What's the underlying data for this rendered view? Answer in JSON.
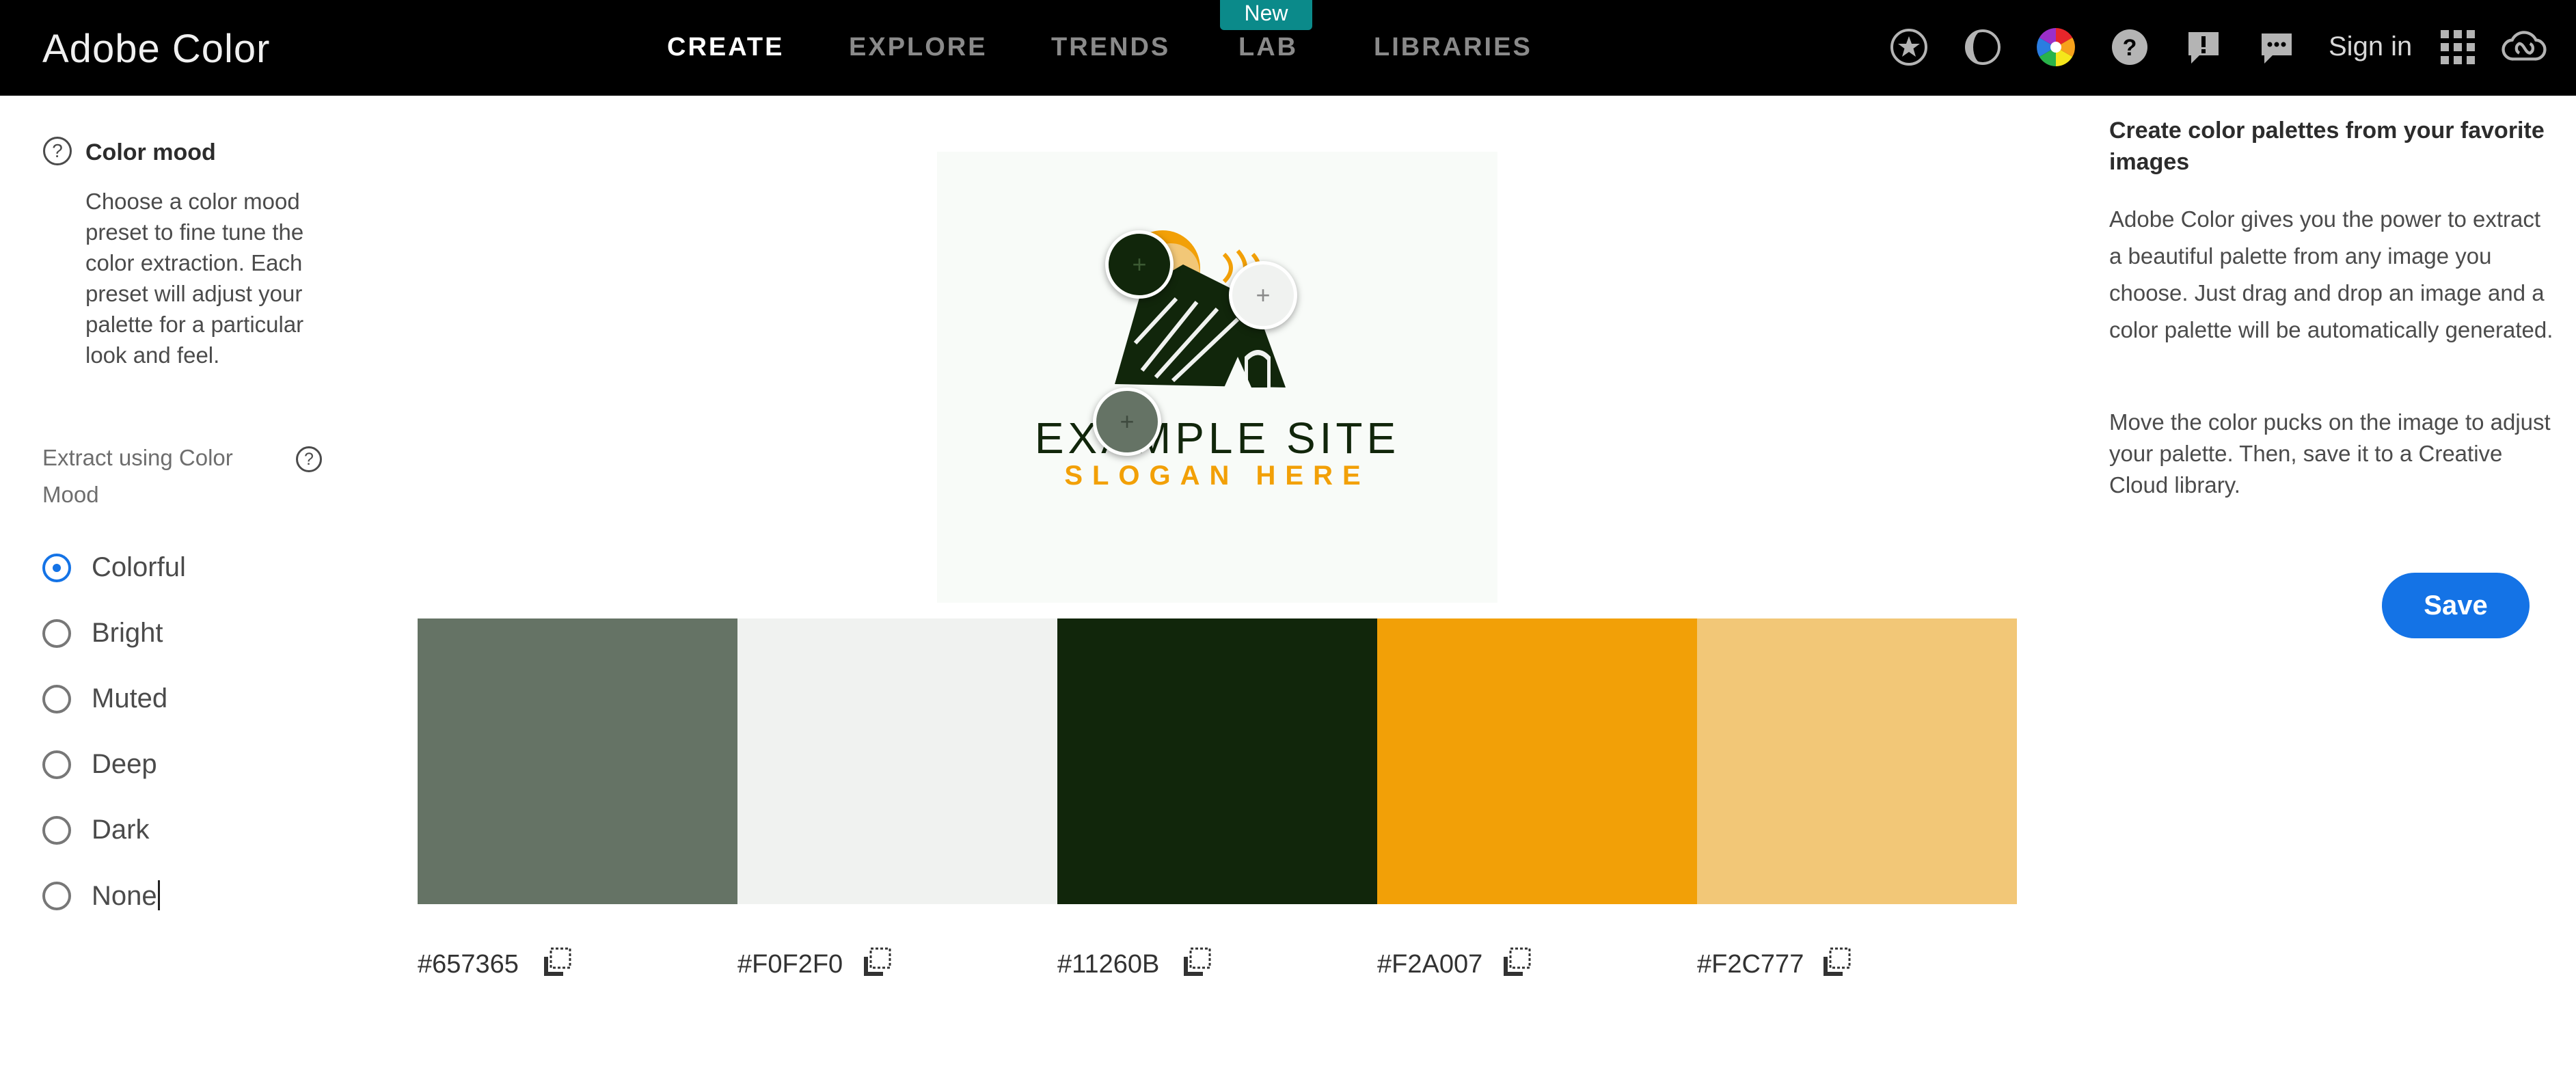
{
  "header": {
    "brand": "Adobe Color",
    "nav": [
      "CREATE",
      "EXPLORE",
      "TRENDS",
      "LAB",
      "LIBRARIES"
    ],
    "active_nav": "CREATE",
    "new_badge": "New",
    "sign_in": "Sign in",
    "icons": [
      "star-icon",
      "contrast-icon",
      "color-wheel-icon",
      "help-icon",
      "alert-icon",
      "feedback-icon",
      "apps-grid-icon",
      "creative-cloud-icon"
    ]
  },
  "left_panel": {
    "title": "Color mood",
    "description": "Choose a color mood preset to fine tune the color extraction. Each preset will adjust your palette for a particular look and feel.",
    "extract_label": "Extract using Color Mood",
    "options": [
      "Colorful",
      "Bright",
      "Muted",
      "Deep",
      "Dark",
      "None"
    ],
    "selected": "Colorful"
  },
  "image": {
    "name": "EXAMPLE SITE",
    "slogan": "SLOGAN HERE"
  },
  "palette": [
    {
      "hex": "#657365",
      "color": "#657365"
    },
    {
      "hex": "#F0F2F0",
      "color": "#F0F2F0"
    },
    {
      "hex": "#11260B",
      "color": "#11260B"
    },
    {
      "hex": "#F2A007",
      "color": "#F2A007"
    },
    {
      "hex": "#F2C777",
      "color": "#F2C777"
    }
  ],
  "right_panel": {
    "title": "Create color palettes from your favorite images",
    "paragraph1": "Adobe Color gives you the power to extract a beautiful palette from any image you choose. Just drag and drop an image and a color palette will be automatically generated.",
    "paragraph2": "Move the color pucks on the image to adjust your palette. Then, save it to a Creative Cloud library.",
    "save_label": "Save"
  },
  "colors": {
    "accent": "#1473e6",
    "badge": "#0b8a8a",
    "topbar": "#000000"
  }
}
